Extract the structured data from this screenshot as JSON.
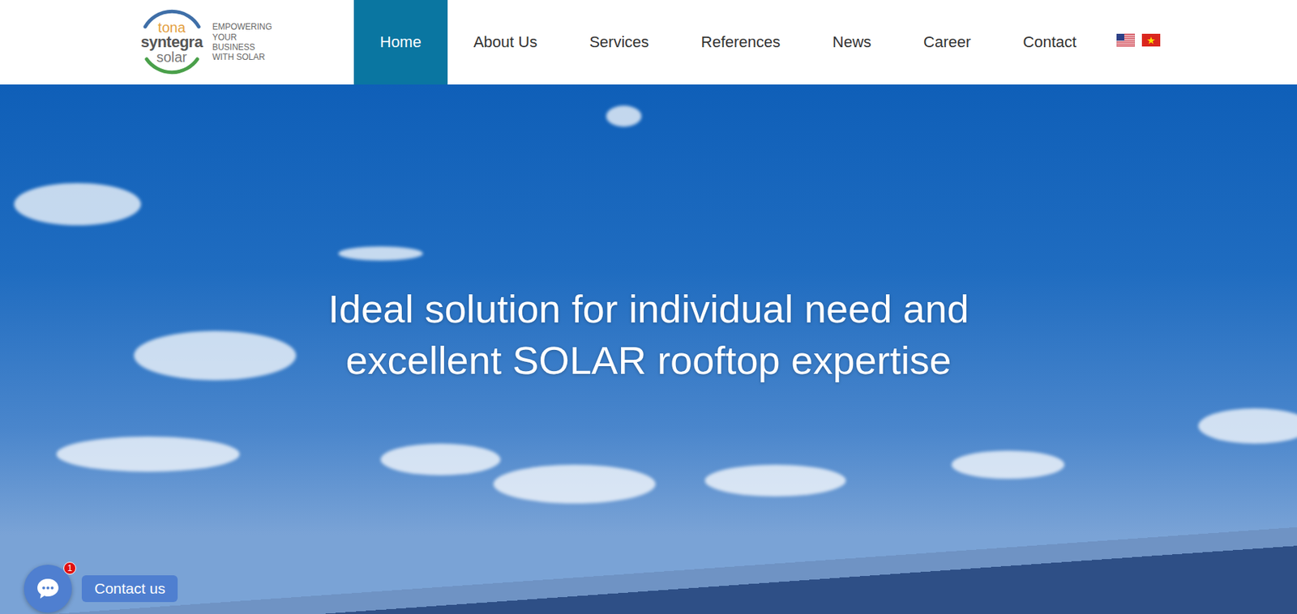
{
  "logo": {
    "words": [
      "tona",
      "syntegra",
      "solar"
    ],
    "tagline": [
      "EMPOWERING",
      "YOUR BUSINESS",
      "WITH SOLAR"
    ]
  },
  "nav": [
    {
      "label": "Home",
      "selected": true
    },
    {
      "label": "About Us",
      "selected": false
    },
    {
      "label": "Services",
      "selected": false
    },
    {
      "label": "References",
      "selected": false
    },
    {
      "label": "News",
      "selected": false
    },
    {
      "label": "Career",
      "selected": false
    },
    {
      "label": "Contact",
      "selected": false
    }
  ],
  "hero": {
    "headline": [
      "Ideal solution for individual need and",
      "excellent SOLAR rooftop expertise"
    ]
  },
  "chat": {
    "badge": "1",
    "label": "Contact us"
  }
}
